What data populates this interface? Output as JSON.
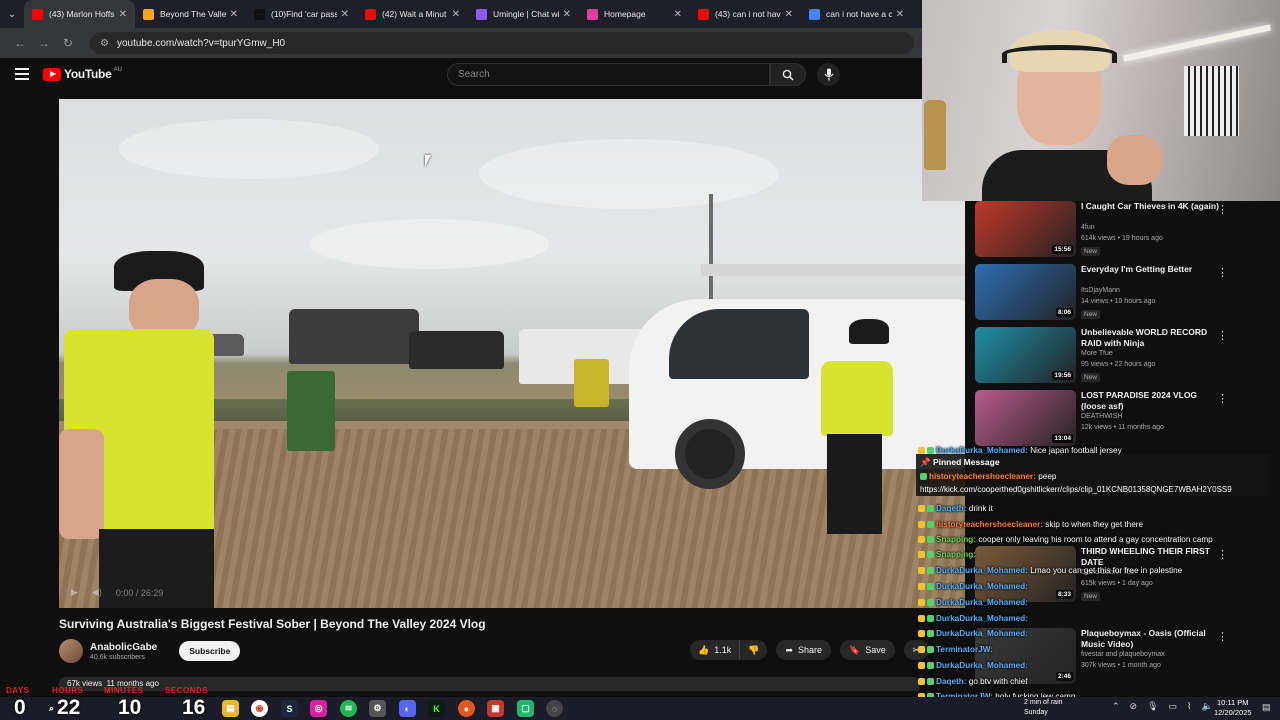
{
  "browser": {
    "tabs": [
      {
        "label": "(43) Marlon Hoffs",
        "color": "#ff0000"
      },
      {
        "label": "Beyond The Valley",
        "color": "#f5a623"
      },
      {
        "label": "(10)Find 'car pass",
        "color": "#111111"
      },
      {
        "label": "(42) Wait a Minut",
        "color": "#ff0000"
      },
      {
        "label": "Umingle | Chat wi",
        "color": "#8a5cf6"
      },
      {
        "label": "Homepage",
        "color": "#e23fa0"
      },
      {
        "label": "(43) can i not hav",
        "color": "#ff0000"
      },
      {
        "label": "can i not have a c",
        "color": "#4285f4"
      }
    ],
    "url": "youtube.com/watch?v=tpurYGmw_H0"
  },
  "youtube": {
    "logo": "YouTube",
    "region": "AU",
    "search_placeholder": "Search",
    "video": {
      "title": "Surviving Australia's Biggest Festival Sober | Beyond The Valley 2024 Vlog",
      "time": "0:00 / 26:29",
      "channel": "AnabolicGabe",
      "subscribers": "40.6k subscribers",
      "subscribe_label": "Subscribe",
      "likes": "1.1k",
      "share_label": "Share",
      "save_label": "Save",
      "views": "67k views",
      "age": "11 months ago"
    },
    "recommendations": [
      {
        "title": "I Caught Car Thieves in 4K (again)",
        "channel": "4fun",
        "views": "614k views",
        "age": "19 hours ago",
        "duration": "15:56",
        "new": "New",
        "thumb": "#c0392b"
      },
      {
        "title": "Everyday I'm Getting Better",
        "channel": "ItsDjayMann",
        "views": "14 views",
        "age": "10 hours ago",
        "duration": "8:06",
        "new": "New",
        "thumb": "#2d6fb5"
      },
      {
        "title": "Unbelievable WORLD RECORD RAID with Ninja",
        "channel": "More Tfue",
        "views": "95 views",
        "age": "22 hours ago",
        "duration": "19:56",
        "new": "New",
        "thumb": "#1e8fa6"
      },
      {
        "title": "LOST PARADISE 2024 VLOG (loose asf)",
        "channel": "DEATHWISH",
        "views": "12k views",
        "age": "11 months ago",
        "duration": "13:04",
        "new": "",
        "thumb": "#b95b8c"
      }
    ],
    "recommendations_lower": [
      {
        "title": "THIRD WHEELING THEIR FIRST DATE",
        "channel": "David Dobrik Too",
        "views": "615k views",
        "age": "1 day ago",
        "duration": "8:33",
        "new": "New",
        "thumb": "#7a5a3a"
      },
      {
        "title": "Plaqueboymax - Oasis (Official Music Video)",
        "channel": "fivestar and plaqueboymax",
        "views": "307k views",
        "age": "1 month ago",
        "duration": "2:46",
        "new": "",
        "thumb": "#3a3a3a"
      }
    ]
  },
  "chat": {
    "pinned_title": "Pinned Message",
    "pinned_user": "historyteachershoecleaner:",
    "pinned_text": "peep",
    "pinned_link": "https://kick.com/cooperthed0gshitlickerr/clips/clip_01KCNB01358QNGE7WBAH2Y0SS9",
    "messages": [
      {
        "user": "DurkaDurka_Mohamed:",
        "text": "Nice japan football jersey",
        "color": "#4fb3ff"
      },
      {
        "user": "Daqeth:",
        "text": "drink it",
        "color": "#4fb3ff"
      },
      {
        "user": "historyteachershoecleaner:",
        "text": "skip to when they get there",
        "color": "#ff7b2a"
      },
      {
        "user": "Snapping:",
        "text": "cooper only leaving his room to attend a gay concentration camp",
        "color": "#72d64a"
      },
      {
        "user": "Snapping:",
        "text": "",
        "color": "#72d64a"
      },
      {
        "user": "DurkaDurka_Mohamed:",
        "text": "Lmao you can get this for free in palestine",
        "color": "#4fb3ff"
      },
      {
        "user": "DurkaDurka_Mohamed:",
        "text": "",
        "color": "#4fb3ff"
      },
      {
        "user": "DurkaDurka_Mohamed:",
        "text": "",
        "color": "#4fb3ff"
      },
      {
        "user": "DurkaDurka_Mohamed:",
        "text": "",
        "color": "#4fb3ff"
      },
      {
        "user": "DurkaDurka_Mohamed:",
        "text": "",
        "color": "#4fb3ff"
      },
      {
        "user": "TerminatorJW:",
        "text": "",
        "color": "#4fb3ff"
      },
      {
        "user": "DurkaDurka_Mohamed:",
        "text": "",
        "color": "#4fb3ff"
      },
      {
        "user": "Daqeth:",
        "text": "go btv with chief",
        "color": "#4fb3ff"
      },
      {
        "user": "TerminatorJW:",
        "text": "holy fucking jew camp",
        "color": "#4fb3ff"
      },
      {
        "user": "Snapping:",
        "text": "",
        "color": "#72d64a"
      }
    ]
  },
  "countdown": {
    "labels": [
      "DAYS",
      "HOURS",
      "MINUTES",
      "SECONDS"
    ],
    "values": [
      "0",
      "22",
      "10",
      "16"
    ]
  },
  "taskbar": {
    "weather_text": "2 min of rain",
    "weather_day": "Sunday",
    "time": "10:11 PM",
    "date": "12/20/2025"
  }
}
